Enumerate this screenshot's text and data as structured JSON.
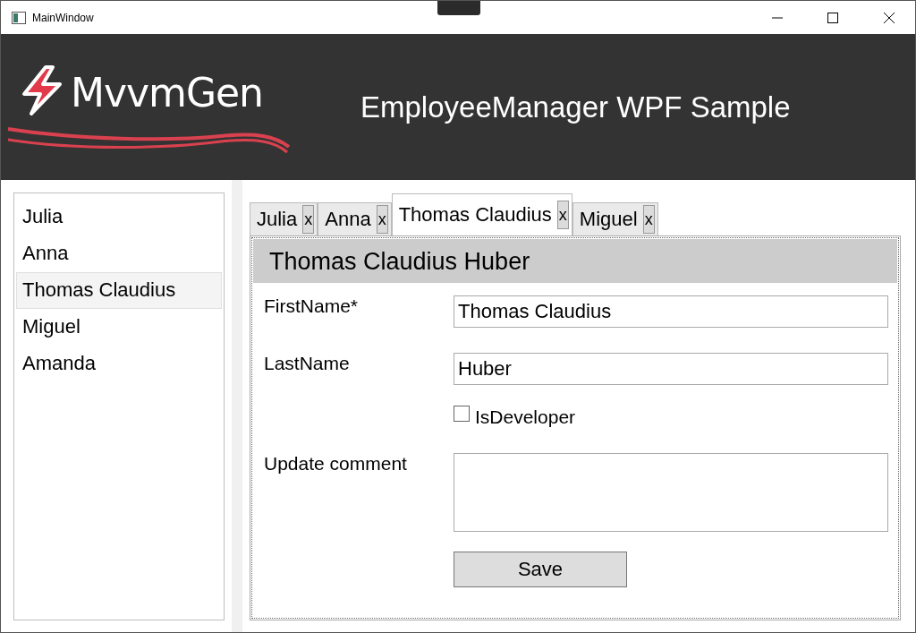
{
  "window": {
    "title": "MainWindow"
  },
  "header": {
    "logo_text": "MvvmGen",
    "title": "EmployeeManager WPF Sample"
  },
  "employee_list": [
    {
      "name": "Julia",
      "selected": false
    },
    {
      "name": "Anna",
      "selected": false
    },
    {
      "name": "Thomas Claudius",
      "selected": true
    },
    {
      "name": "Miguel",
      "selected": false
    },
    {
      "name": "Amanda",
      "selected": false
    }
  ],
  "tabs": [
    {
      "label": "Julia",
      "close": "x",
      "selected": false
    },
    {
      "label": "Anna",
      "close": "x",
      "selected": false
    },
    {
      "label": "Thomas Claudius",
      "close": "x",
      "selected": true
    },
    {
      "label": "Miguel",
      "close": "x",
      "selected": false
    }
  ],
  "detail": {
    "heading": "Thomas Claudius Huber",
    "first_name": {
      "label": "FirstName*",
      "value": "Thomas Claudius"
    },
    "last_name": {
      "label": "LastName",
      "value": "Huber"
    },
    "is_developer": {
      "label": "IsDeveloper",
      "checked": false
    },
    "update_comment": {
      "label": "Update comment"
    },
    "save_button": "Save"
  }
}
